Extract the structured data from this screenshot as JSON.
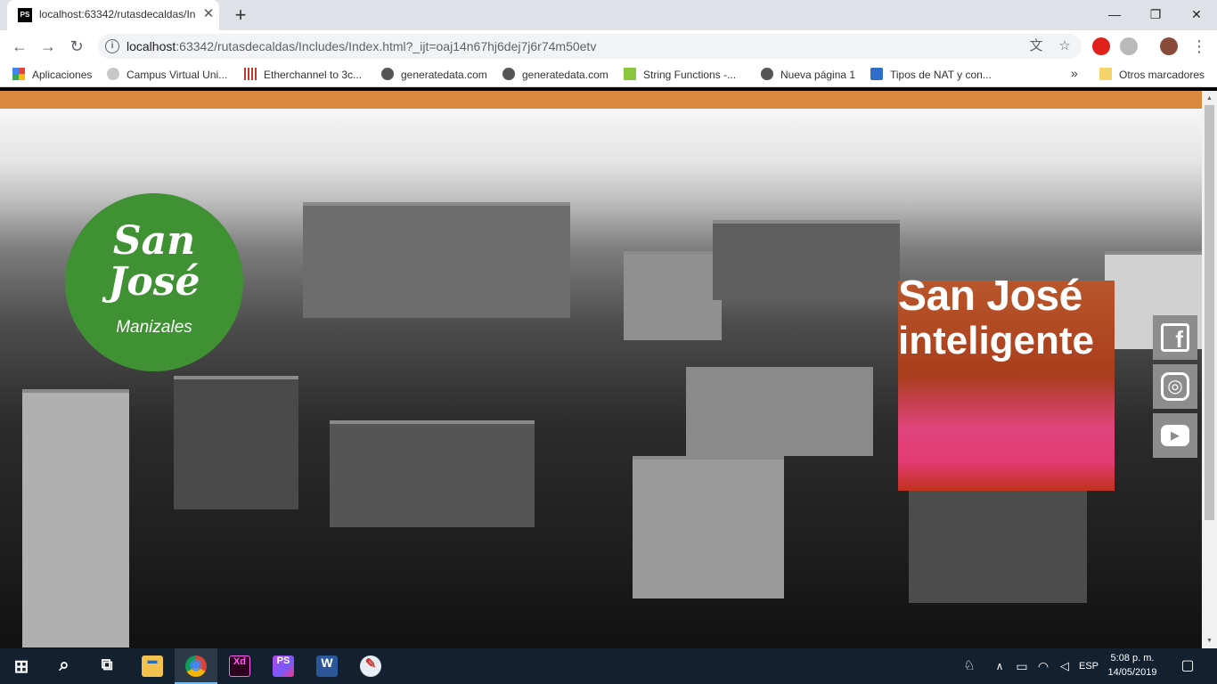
{
  "browser": {
    "tab": {
      "favicon": "PS",
      "title": "localhost:63342/rutasdecaldas/In",
      "close_glyph": "✕"
    },
    "new_tab_glyph": "+",
    "window_controls": {
      "minimize_glyph": "—",
      "maximize_glyph": "❐",
      "close_glyph": "✕"
    },
    "nav": {
      "back_glyph": "←",
      "forward_glyph": "→",
      "reload_glyph": "↻"
    },
    "address": {
      "info_glyph": "i",
      "host": "localhost",
      "rest": ":63342/rutasdecaldas/Includes/Index.html?_ijt=oaj14n67hj6dej7j6r74m50etv"
    },
    "omnibox_icons": {
      "translate_glyph": "文",
      "bookmark_star_glyph": "☆"
    },
    "menu_glyph": "⋮",
    "bookmarks": {
      "items": [
        {
          "label": "Aplicaciones"
        },
        {
          "label": "Campus Virtual Uni..."
        },
        {
          "label": "Etherchannel to 3c..."
        },
        {
          "label": "generatedata.com"
        },
        {
          "label": "generatedata.com"
        },
        {
          "label": "String Functions -..."
        },
        {
          "label": "Nueva página 1"
        },
        {
          "label": "Tipos de NAT y con..."
        }
      ],
      "overflow_glyph": "»",
      "other_folder": "Otros marcadores"
    }
  },
  "page": {
    "accent_color": "#d9883d",
    "logo": {
      "line1": "San",
      "line2": "José",
      "city": "Manizales",
      "color": "#3f9134"
    },
    "feature": {
      "title": "San José",
      "subtitle": "inteligente"
    },
    "social": [
      {
        "name": "facebook",
        "glyph": "f"
      },
      {
        "name": "instagram",
        "glyph": "◎"
      },
      {
        "name": "youtube",
        "glyph": "▶"
      }
    ],
    "scrollbar": {
      "up_glyph": "▲",
      "down_glyph": "▼"
    }
  },
  "taskbar": {
    "start_glyph": "⊞",
    "search_glyph": "⌕",
    "taskview_glyph": "⧉",
    "apps": [
      {
        "name": "file-explorer",
        "glyph": "▬"
      },
      {
        "name": "chrome",
        "glyph": "◉"
      },
      {
        "name": "adobe-xd",
        "glyph": "Xd"
      },
      {
        "name": "phpstorm",
        "glyph": "PS"
      },
      {
        "name": "word",
        "glyph": "W"
      },
      {
        "name": "paint",
        "glyph": "✎"
      }
    ],
    "tray": {
      "people_glyph": "♘",
      "up_arrow_glyph": "∧",
      "battery_glyph": "▭",
      "wifi_glyph": "◠",
      "volume_glyph": "◁",
      "language": "ESP",
      "time": "5:08 p. m.",
      "date": "14/05/2019",
      "notifications_glyph": "▢"
    }
  }
}
